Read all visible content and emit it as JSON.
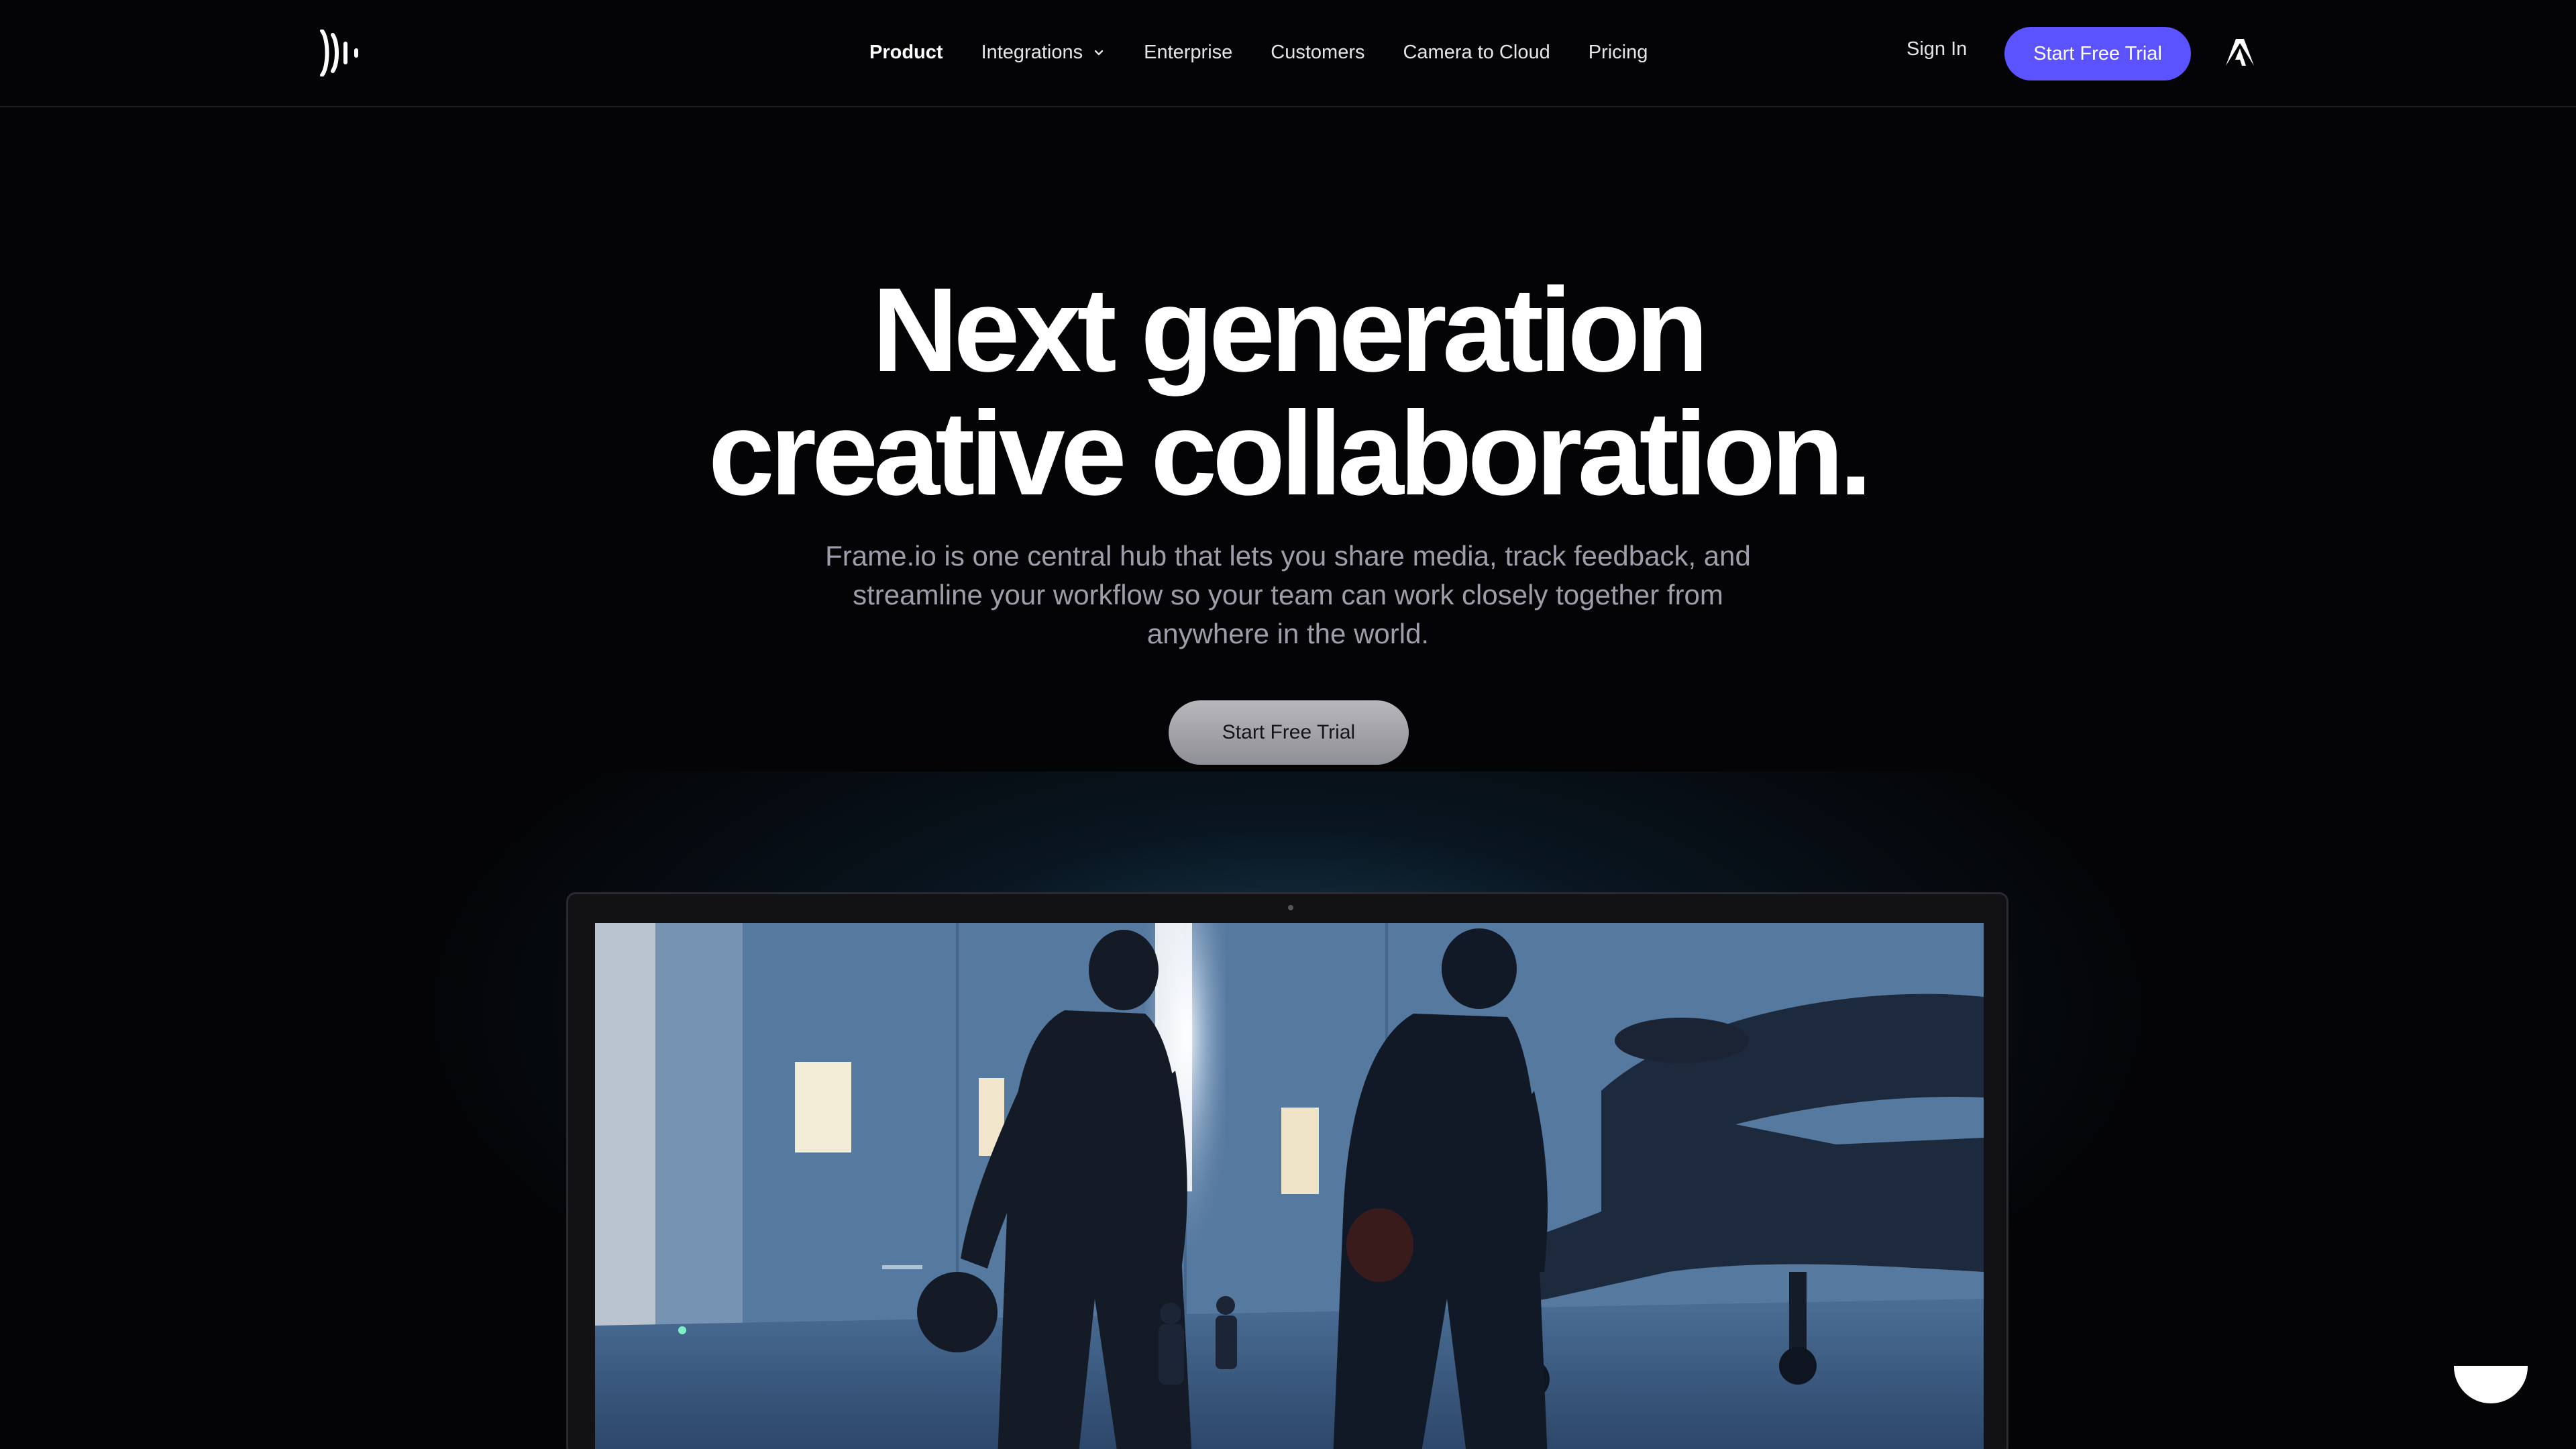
{
  "nav": {
    "logo_icon": "frameio-logo-icon",
    "links": [
      {
        "label": "Product",
        "active": true
      },
      {
        "label": "Integrations",
        "has_dropdown": true
      },
      {
        "label": "Enterprise"
      },
      {
        "label": "Customers"
      },
      {
        "label": "Camera to Cloud"
      },
      {
        "label": "Pricing"
      }
    ],
    "sign_in": "Sign In",
    "cta": "Start Free Trial",
    "adobe_icon": "adobe-logo-icon"
  },
  "hero": {
    "title_line1": "Next generation",
    "title_line2": "creative collaboration.",
    "subtitle": "Frame.io is one central hub that lets you share media, track feedback, and streamline your workflow so your team can work closely together from anywhere in the world.",
    "cta": "Start Free Trial"
  },
  "video": {
    "description_icon": "hero-video-still"
  },
  "colors": {
    "background": "#040406",
    "accent": "#5b53ff",
    "subtitle": "#9e9eaa",
    "secondary_button": "#a3a3a9"
  },
  "chat_widget_icon": "chat-launcher-icon"
}
